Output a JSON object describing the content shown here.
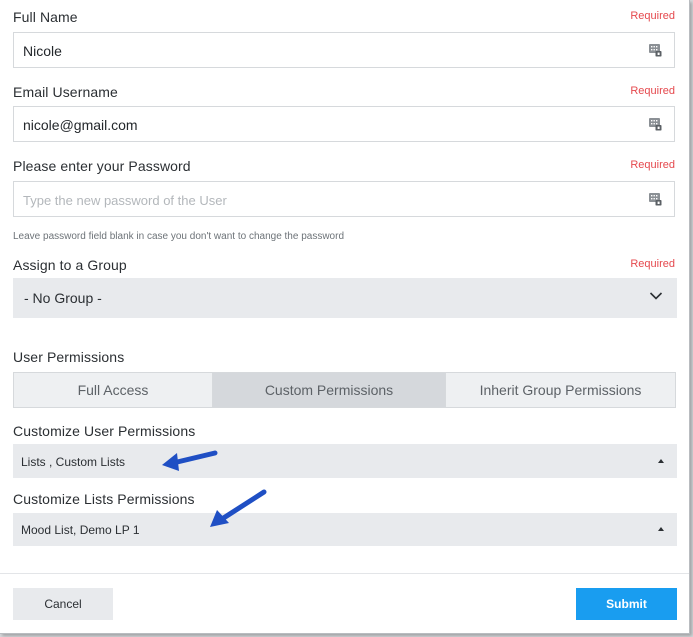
{
  "form": {
    "full_name": {
      "label": "Full Name",
      "required": "Required",
      "value": "Nicole",
      "icon": "keypad-icon"
    },
    "email": {
      "label": "Email Username",
      "required": "Required",
      "value": "nicole@gmail.com",
      "icon": "keypad-icon"
    },
    "password": {
      "label": "Please enter your Password",
      "required": "Required",
      "placeholder": "Type the new password of the User",
      "hint": "Leave password field blank in case you don't want to change the password",
      "icon": "keypad-icon"
    },
    "group": {
      "label": "Assign to a Group",
      "required": "Required",
      "value": "- No Group -",
      "icon": "chevron-down-icon"
    },
    "permissions": {
      "label": "User Permissions",
      "options": [
        "Full Access",
        "Custom Permissions",
        "Inherit Group Permissions"
      ],
      "selected": "Custom Permissions"
    },
    "user_permissions": {
      "label": "Customize User Permissions",
      "value": "Lists , Custom Lists",
      "icon": "caret-up-icon"
    },
    "lists_permissions": {
      "label": "Customize Lists Permissions",
      "value": "Mood List, Demo LP 1",
      "icon": "caret-up-icon"
    }
  },
  "footer": {
    "cancel_label": "Cancel",
    "submit_label": "Submit"
  },
  "colors": {
    "required": "#e5484d",
    "submit": "#199df0",
    "annotation_arrow": "#2a5fd6",
    "select_bg": "#e8eaed",
    "segment_active": "#d5d8dc"
  }
}
